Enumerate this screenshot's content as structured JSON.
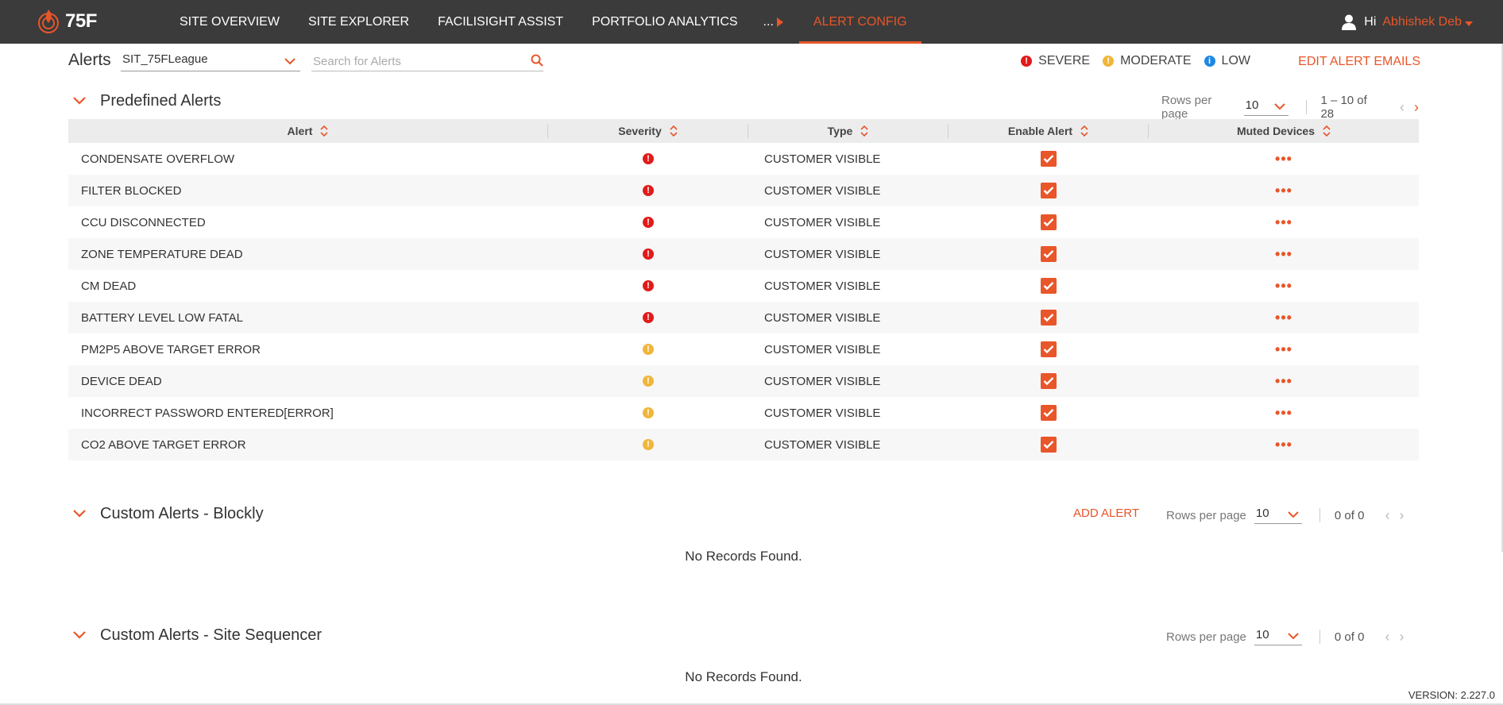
{
  "brand": {
    "logo_text": "75F",
    "accent": "#e8562a"
  },
  "nav": {
    "items": [
      "SITE OVERVIEW",
      "SITE EXPLORER",
      "FACILISIGHT ASSIST",
      "PORTFOLIO ANALYTICS"
    ],
    "more_label": "...",
    "active_label": "ALERT CONFIG"
  },
  "user": {
    "greeting": "Hi",
    "name": "Abhishek Deb"
  },
  "alerts_header": {
    "title": "Alerts",
    "site": "SIT_75FLeague",
    "search_placeholder": "Search for Alerts",
    "legend": [
      {
        "label": "SEVERE",
        "color": "#e11b1b"
      },
      {
        "label": "MODERATE",
        "color": "#f0b63a"
      },
      {
        "label": "LOW",
        "color": "#1e88e5"
      }
    ],
    "edit_emails_label": "EDIT ALERT EMAILS"
  },
  "predefined": {
    "title": "Predefined Alerts",
    "rows_per_page_label": "Rows per page",
    "rows_per_page": "10",
    "range": "1 – 10 of 28",
    "columns": [
      "Alert",
      "Severity",
      "Type",
      "Enable Alert",
      "Muted Devices"
    ],
    "rows": [
      {
        "alert": "CONDENSATE OVERFLOW",
        "severity": "severe",
        "type": "CUSTOMER VISIBLE",
        "enabled": true
      },
      {
        "alert": "FILTER BLOCKED",
        "severity": "severe",
        "type": "CUSTOMER VISIBLE",
        "enabled": true
      },
      {
        "alert": "CCU DISCONNECTED",
        "severity": "severe",
        "type": "CUSTOMER VISIBLE",
        "enabled": true
      },
      {
        "alert": "ZONE TEMPERATURE DEAD",
        "severity": "severe",
        "type": "CUSTOMER VISIBLE",
        "enabled": true
      },
      {
        "alert": "CM DEAD",
        "severity": "severe",
        "type": "CUSTOMER VISIBLE",
        "enabled": true
      },
      {
        "alert": "BATTERY LEVEL LOW FATAL",
        "severity": "severe",
        "type": "CUSTOMER VISIBLE",
        "enabled": true
      },
      {
        "alert": "PM2P5 ABOVE TARGET ERROR",
        "severity": "moderate",
        "type": "CUSTOMER VISIBLE",
        "enabled": true
      },
      {
        "alert": "DEVICE DEAD",
        "severity": "moderate",
        "type": "CUSTOMER VISIBLE",
        "enabled": true
      },
      {
        "alert": "INCORRECT PASSWORD ENTERED[ERROR]",
        "severity": "moderate",
        "type": "CUSTOMER VISIBLE",
        "enabled": true
      },
      {
        "alert": "CO2 ABOVE TARGET ERROR",
        "severity": "moderate",
        "type": "CUSTOMER VISIBLE",
        "enabled": true
      }
    ],
    "muted_icon": "more-horizontal-icon"
  },
  "blockly": {
    "title": "Custom Alerts - Blockly",
    "add_label": "ADD ALERT",
    "rows_per_page_label": "Rows per page",
    "rows_per_page": "10",
    "range": "0 of 0",
    "empty_text": "No Records Found."
  },
  "sequencer": {
    "title": "Custom Alerts - Site Sequencer",
    "rows_per_page_label": "Rows per page",
    "rows_per_page": "10",
    "range": "0 of 0",
    "empty_text": "No Records Found."
  },
  "footer": {
    "version": "VERSION: 2.227.0"
  }
}
